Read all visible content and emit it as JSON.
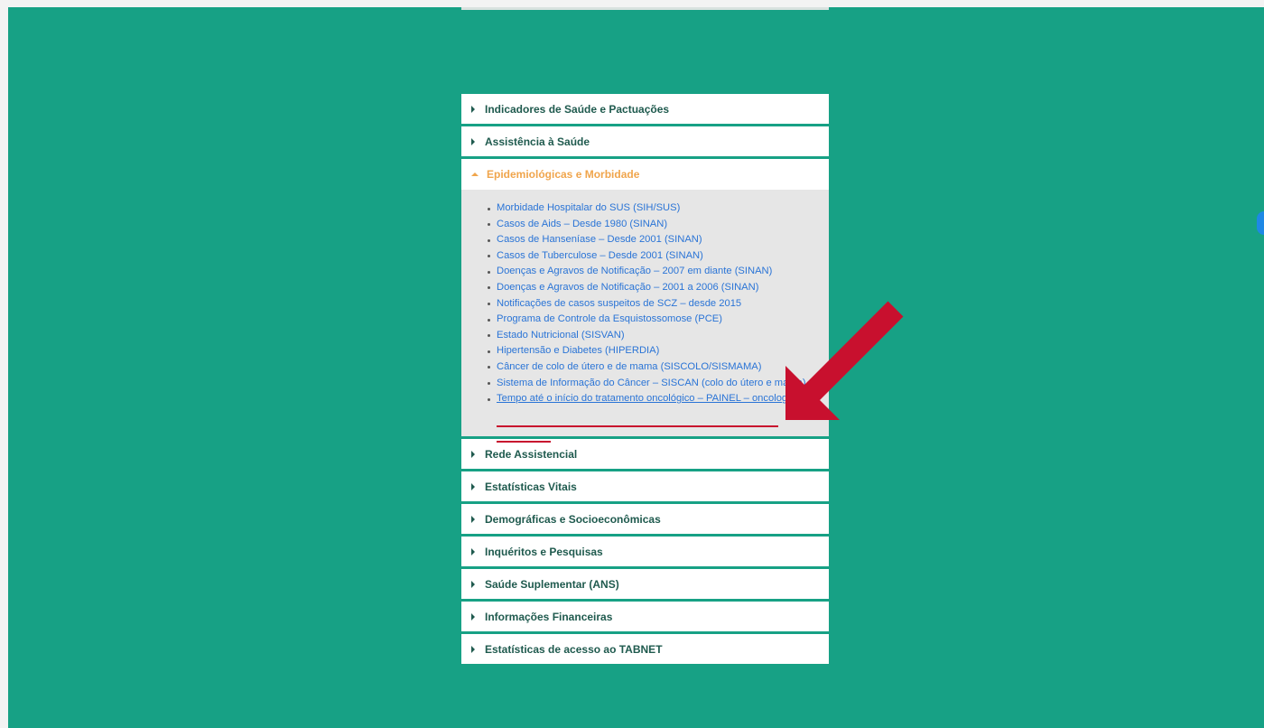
{
  "accordion": {
    "items": [
      {
        "label": "Indicadores de Saúde e Pactuações"
      },
      {
        "label": "Assistência à Saúde"
      },
      {
        "label": "Epidemiológicas e Morbidade"
      },
      {
        "label": "Rede Assistencial"
      },
      {
        "label": "Estatísticas Vitais"
      },
      {
        "label": "Demográficas e Socioeconômicas"
      },
      {
        "label": "Inquéritos e Pesquisas"
      },
      {
        "label": "Saúde Suplementar (ANS)"
      },
      {
        "label": "Informações Financeiras"
      },
      {
        "label": "Estatísticas de acesso ao TABNET"
      }
    ],
    "open_index": 2,
    "open_links": [
      "Morbidade Hospitalar do SUS (SIH/SUS)",
      "Casos de Aids – Desde 1980 (SINAN)",
      "Casos de Hanseníase – Desde 2001 (SINAN)",
      "Casos de Tuberculose – Desde 2001 (SINAN)",
      "Doenças e Agravos de Notificação – 2007 em diante (SINAN)",
      "Doenças e Agravos de Notificação – 2001 a 2006 (SINAN)",
      "Notificações de casos suspeitos de SCZ – desde 2015",
      "Programa de Controle da Esquistossomose (PCE)",
      "Estado Nutricional (SISVAN)",
      "Hipertensão e Diabetes (HIPERDIA)",
      "Câncer de colo de útero e de mama (SISCOLO/SISMAMA)",
      "Sistema de Informação do Câncer – SISCAN (colo do útero e mama)",
      "Tempo até o início do tratamento oncológico – PAINEL – oncologia"
    ]
  },
  "colors": {
    "background": "#17a185",
    "header_text": "#1f5a4e",
    "active_header": "#f0a54c",
    "link": "#2a74d6",
    "annotation": "#c8102e"
  },
  "icons": {
    "collapsed": "caret-right-icon",
    "expanded": "caret-up-icon",
    "annotation": "red-arrow-icon"
  }
}
